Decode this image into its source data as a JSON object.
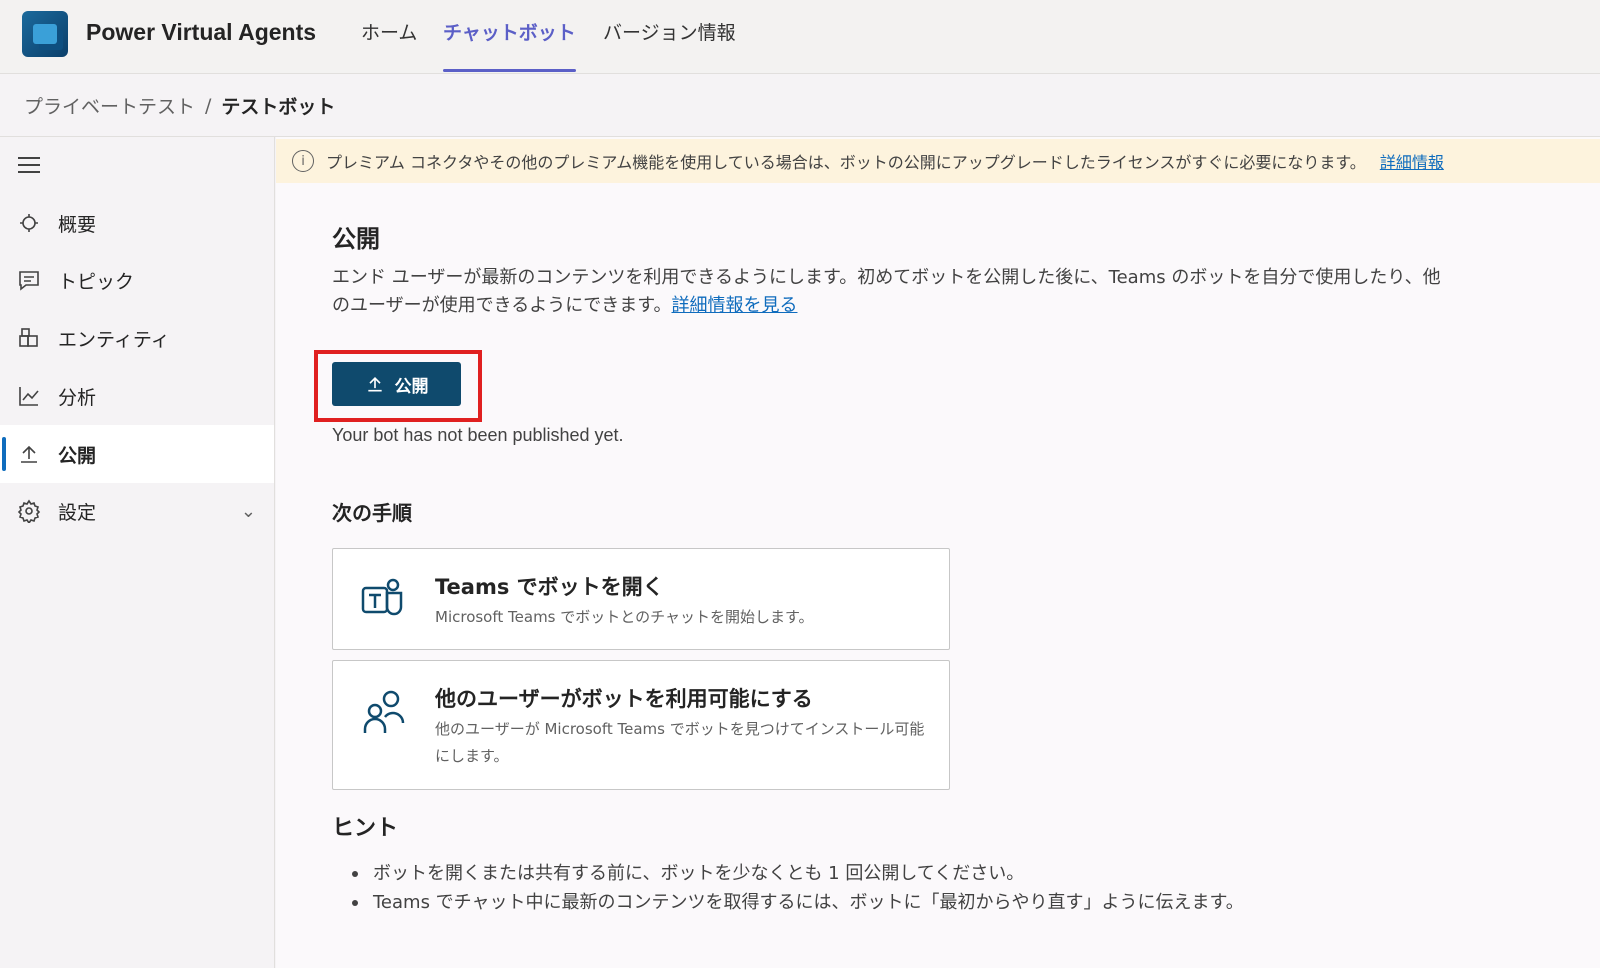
{
  "header": {
    "app_title": "Power Virtual Agents",
    "tabs": [
      {
        "label": "ホーム"
      },
      {
        "label": "チャットボット"
      },
      {
        "label": "バージョン情報"
      }
    ]
  },
  "breadcrumb": {
    "parent": "プライベートテスト",
    "separator": "/",
    "current": "テストボット"
  },
  "sidebar": {
    "items": [
      {
        "label": "概要",
        "icon": "overview-icon"
      },
      {
        "label": "トピック",
        "icon": "topic-icon"
      },
      {
        "label": "エンティティ",
        "icon": "entity-icon"
      },
      {
        "label": "分析",
        "icon": "analytics-icon"
      },
      {
        "label": "公開",
        "icon": "publish-icon",
        "active": true
      },
      {
        "label": "設定",
        "icon": "gear-icon"
      }
    ]
  },
  "banner": {
    "text": "プレミアム コネクタやその他のプレミアム機能を使用している場合は、ボットの公開にアップグレードしたライセンスがすぐに必要になります。",
    "link": "詳細情報"
  },
  "main": {
    "title": "公開",
    "description": "エンド ユーザーが最新のコンテンツを利用できるようにします。初めてボットを公開した後に、Teams のボットを自分で使用したり、他のユーザーが使用できるようにできます。",
    "description_link": "詳細情報を見る",
    "publish_button": "公開",
    "status": "Your bot has not been published yet.",
    "next_steps_title": "次の手順",
    "cards": [
      {
        "title": "Teams でボットを開く",
        "subtitle": "Microsoft Teams でボットとのチャットを開始します。",
        "icon": "teams-icon"
      },
      {
        "title": "他のユーザーがボットを利用可能にする",
        "subtitle": "他のユーザーが Microsoft Teams でボットを見つけてインストール可能にします。",
        "icon": "people-icon"
      }
    ],
    "hint_title": "ヒント",
    "hints": [
      "ボットを開くまたは共有する前に、ボットを少なくとも 1 回公開してください。",
      "Teams でチャット中に最新のコンテンツを取得するには、ボットに「最初からやり直す」ように伝えます。"
    ]
  },
  "colors": {
    "accent": "#5b5fc7",
    "publish_button": "#0f4a6d",
    "link": "#0f6cbd",
    "banner_bg": "#fdf3dd",
    "highlight": "#e02020"
  }
}
